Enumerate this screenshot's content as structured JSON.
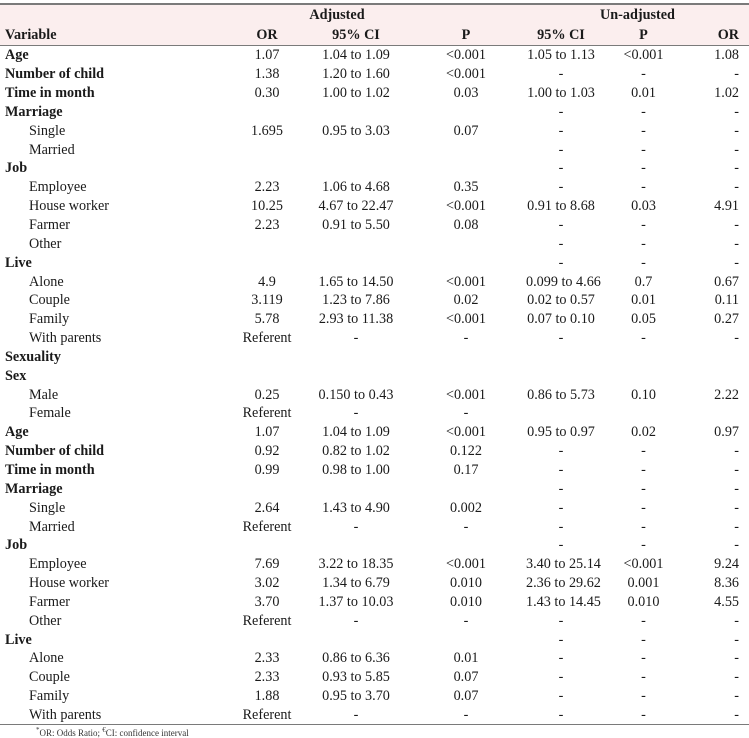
{
  "header": {
    "group_adjusted": "Adjusted",
    "group_unadjusted": "Un-adjusted",
    "columns": [
      "Variable",
      "OR",
      "95% CI",
      "P",
      "95% CI",
      "P",
      "OR"
    ]
  },
  "rows": [
    {
      "variable": "Age",
      "level": "head",
      "adj_or": "1.07",
      "adj_ci": "1.04 to 1.09",
      "adj_p": "<0.001",
      "un_ci": "1.05 to 1.13",
      "un_p": "<0.001",
      "un_or": "1.08"
    },
    {
      "variable": "Number of child",
      "level": "head",
      "adj_or": "1.38",
      "adj_ci": "1.20 to 1.60",
      "adj_p": "<0.001",
      "un_ci": "-",
      "un_p": "-",
      "un_or": "-"
    },
    {
      "variable": "Time in month",
      "level": "head",
      "adj_or": "0.30",
      "adj_ci": "1.00 to 1.02",
      "adj_p": "0.03",
      "un_ci": "1.00 to 1.03",
      "un_p": "0.01",
      "un_or": "1.02"
    },
    {
      "variable": "Marriage",
      "level": "head",
      "adj_or": "",
      "adj_ci": "",
      "adj_p": "",
      "un_ci": "-",
      "un_p": "-",
      "un_or": "-"
    },
    {
      "variable": "Single",
      "level": "sub",
      "adj_or": "1.695",
      "adj_ci": "0.95 to 3.03",
      "adj_p": "0.07",
      "un_ci": "-",
      "un_p": "-",
      "un_or": "-"
    },
    {
      "variable": "Married",
      "level": "sub",
      "adj_or": "",
      "adj_ci": "",
      "adj_p": "",
      "un_ci": "-",
      "un_p": "-",
      "un_or": "-"
    },
    {
      "variable": "Job",
      "level": "head",
      "adj_or": "",
      "adj_ci": "",
      "adj_p": "",
      "un_ci": "-",
      "un_p": "-",
      "un_or": "-"
    },
    {
      "variable": "Employee",
      "level": "sub",
      "adj_or": "2.23",
      "adj_ci": "1.06 to 4.68",
      "adj_p": "0.35",
      "un_ci": "-",
      "un_p": "-",
      "un_or": "-"
    },
    {
      "variable": "House worker",
      "level": "sub",
      "adj_or": "10.25",
      "adj_ci": "4.67 to 22.47",
      "adj_p": "<0.001",
      "un_ci": "0.91 to 8.68",
      "un_p": "0.03",
      "un_or": "4.91"
    },
    {
      "variable": "Farmer",
      "level": "sub",
      "adj_or": "2.23",
      "adj_ci": "0.91 to 5.50",
      "adj_p": "0.08",
      "un_ci": "-",
      "un_p": "-",
      "un_or": "-"
    },
    {
      "variable": "Other",
      "level": "sub",
      "adj_or": "",
      "adj_ci": "",
      "adj_p": "",
      "un_ci": "-",
      "un_p": "-",
      "un_or": "-"
    },
    {
      "variable": "Live",
      "level": "head",
      "adj_or": "",
      "adj_ci": "",
      "adj_p": "",
      "un_ci": "-",
      "un_p": "-",
      "un_or": "-"
    },
    {
      "variable": "Alone",
      "level": "sub",
      "adj_or": "4.9",
      "adj_ci": "1.65 to 14.50",
      "adj_p": "<0.001",
      "un_ci": "0.099 to 4.66",
      "un_p": "0.7",
      "un_or": "0.67"
    },
    {
      "variable": "Couple",
      "level": "sub",
      "adj_or": "3.119",
      "adj_ci": "1.23 to 7.86",
      "adj_p": "0.02",
      "un_ci": "0.02 to 0.57",
      "un_p": "0.01",
      "un_or": "0.11"
    },
    {
      "variable": "Family",
      "level": "sub",
      "adj_or": "5.78",
      "adj_ci": "2.93 to 11.38",
      "adj_p": "<0.001",
      "un_ci": "0.07 to 0.10",
      "un_p": "0.05",
      "un_or": "0.27"
    },
    {
      "variable": "With parents",
      "level": "sub",
      "adj_or": "Referent",
      "adj_ci": "-",
      "adj_p": "-",
      "un_ci": "-",
      "un_p": "-",
      "un_or": "-"
    },
    {
      "variable": "Sexuality",
      "level": "head",
      "adj_or": "",
      "adj_ci": "",
      "adj_p": "",
      "un_ci": "",
      "un_p": "",
      "un_or": ""
    },
    {
      "variable": "Sex",
      "level": "head",
      "adj_or": "",
      "adj_ci": "",
      "adj_p": "",
      "un_ci": "",
      "un_p": "",
      "un_or": ""
    },
    {
      "variable": "Male",
      "level": "sub",
      "adj_or": "0.25",
      "adj_ci": "0.150 to 0.43",
      "adj_p": "<0.001",
      "un_ci": "0.86 to 5.73",
      "un_p": "0.10",
      "un_or": "2.22"
    },
    {
      "variable": "Female",
      "level": "sub",
      "adj_or": "Referent",
      "adj_ci": "-",
      "adj_p": "-",
      "un_ci": "",
      "un_p": "",
      "un_or": ""
    },
    {
      "variable": "Age",
      "level": "head",
      "adj_or": "1.07",
      "adj_ci": "1.04 to 1.09",
      "adj_p": "<0.001",
      "un_ci": "0.95 to 0.97",
      "un_p": "0.02",
      "un_or": "0.97"
    },
    {
      "variable": "Number of child",
      "level": "head",
      "adj_or": "0.92",
      "adj_ci": "0.82 to 1.02",
      "adj_p": "0.122",
      "un_ci": "-",
      "un_p": "-",
      "un_or": "-"
    },
    {
      "variable": "Time in month",
      "level": "head",
      "adj_or": "0.99",
      "adj_ci": "0.98 to 1.00",
      "adj_p": "0.17",
      "un_ci": "-",
      "un_p": "-",
      "un_or": "-"
    },
    {
      "variable": "Marriage",
      "level": "head",
      "adj_or": "",
      "adj_ci": "",
      "adj_p": "",
      "un_ci": "-",
      "un_p": "-",
      "un_or": "-"
    },
    {
      "variable": "Single",
      "level": "sub",
      "adj_or": "2.64",
      "adj_ci": "1.43 to 4.90",
      "adj_p": "0.002",
      "un_ci": "-",
      "un_p": "-",
      "un_or": "-"
    },
    {
      "variable": "Married",
      "level": "sub",
      "adj_or": "Referent",
      "adj_ci": "-",
      "adj_p": "-",
      "un_ci": "-",
      "un_p": "-",
      "un_or": "-"
    },
    {
      "variable": "Job",
      "level": "head",
      "adj_or": "",
      "adj_ci": "",
      "adj_p": "",
      "un_ci": "-",
      "un_p": "-",
      "un_or": "-"
    },
    {
      "variable": "Employee",
      "level": "sub",
      "adj_or": "7.69",
      "adj_ci": "3.22 to 18.35",
      "adj_p": "<0.001",
      "un_ci": "3.40 to 25.14",
      "un_p": "<0.001",
      "un_or": "9.24"
    },
    {
      "variable": "House worker",
      "level": "sub",
      "adj_or": "3.02",
      "adj_ci": "1.34 to 6.79",
      "adj_p": "0.010",
      "un_ci": "2.36 to 29.62",
      "un_p": "0.001",
      "un_or": "8.36"
    },
    {
      "variable": "Farmer",
      "level": "sub",
      "adj_or": "3.70",
      "adj_ci": "1.37 to 10.03",
      "adj_p": "0.010",
      "un_ci": "1.43 to 14.45",
      "un_p": "0.010",
      "un_or": "4.55"
    },
    {
      "variable": "Other",
      "level": "sub",
      "adj_or": "Referent",
      "adj_ci": "-",
      "adj_p": "-",
      "un_ci": "-",
      "un_p": "-",
      "un_or": "-"
    },
    {
      "variable": "Live",
      "level": "head",
      "adj_or": "",
      "adj_ci": "",
      "adj_p": "",
      "un_ci": "-",
      "un_p": "-",
      "un_or": "-"
    },
    {
      "variable": "Alone",
      "level": "sub",
      "adj_or": "2.33",
      "adj_ci": "0.86 to 6.36",
      "adj_p": "0.01",
      "un_ci": "-",
      "un_p": "-",
      "un_or": "-"
    },
    {
      "variable": "Couple",
      "level": "sub",
      "adj_or": "2.33",
      "adj_ci": "0.93 to 5.85",
      "adj_p": "0.07",
      "un_ci": "-",
      "un_p": "-",
      "un_or": "-"
    },
    {
      "variable": "Family",
      "level": "sub",
      "adj_or": "1.88",
      "adj_ci": "0.95 to 3.70",
      "adj_p": "0.07",
      "un_ci": "-",
      "un_p": "-",
      "un_or": "-"
    },
    {
      "variable": "With parents",
      "level": "sub",
      "adj_or": "Referent",
      "adj_ci": "-",
      "adj_p": "-",
      "un_ci": "-",
      "un_p": "-",
      "un_or": "-"
    }
  ],
  "footnote": {
    "mark1": "*",
    "text1": "OR: Odds Ratio; ",
    "mark2": "€",
    "text2": "CI: confidence interval"
  },
  "colors": {
    "header_bg": "#fbeeee",
    "rule": "#7a7a7a",
    "text": "#1a1a1a"
  }
}
